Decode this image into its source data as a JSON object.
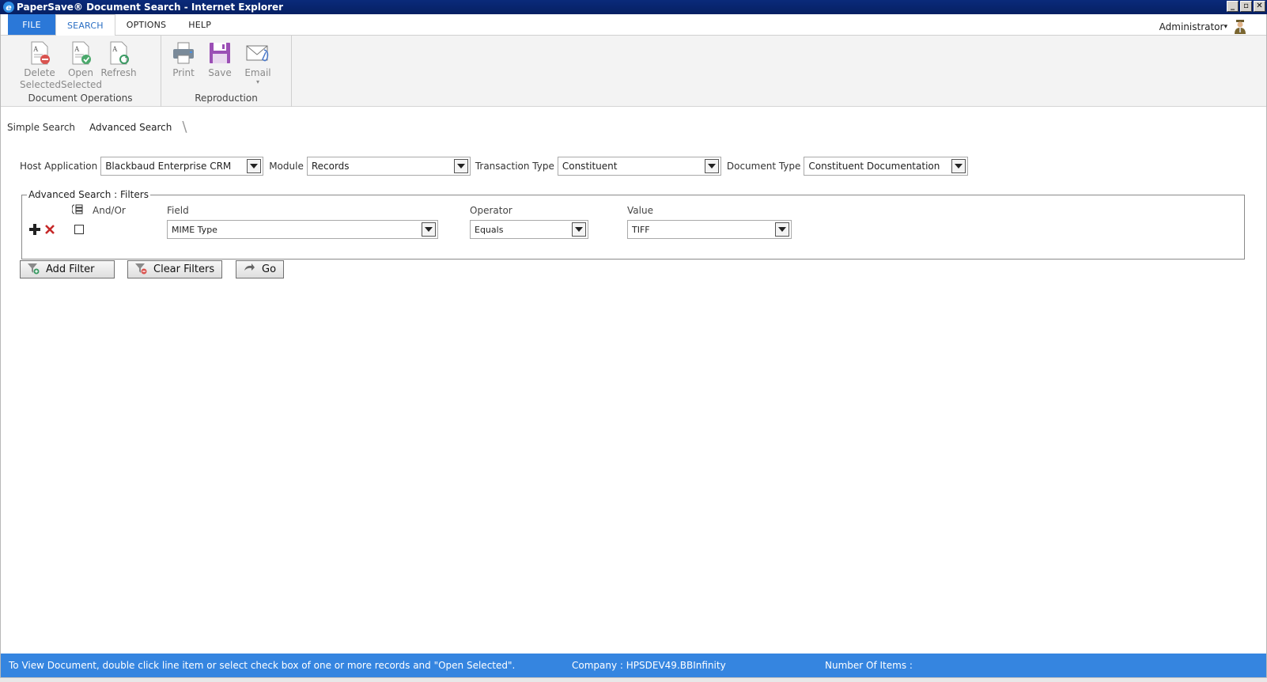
{
  "window": {
    "title": "PaperSave® Document Search - Internet Explorer",
    "icon_letter": "e",
    "minimize": "_",
    "restore": "▫",
    "close": "✕"
  },
  "menu": {
    "file": "FILE",
    "search": "SEARCH",
    "options": "OPTIONS",
    "help": "HELP",
    "user": "Administrator",
    "user_caret": "▾"
  },
  "ribbon": {
    "document_operations": {
      "label": "Document Operations",
      "delete_line1": "Delete",
      "delete_line2": "Selected",
      "open_line1": "Open",
      "open_line2": "Selected",
      "refresh": "Refresh"
    },
    "reproduction": {
      "label": "Reproduction",
      "print": "Print",
      "save": "Save",
      "email": "Email",
      "email_caret": "▾"
    }
  },
  "search_tabs": {
    "simple": "Simple Search",
    "advanced": "Advanced Search",
    "slash": "\\"
  },
  "criteria": {
    "host_application_label": "Host Application",
    "host_application_value": "Blackbaud Enterprise CRM",
    "module_label": "Module",
    "module_value": "Records",
    "transaction_type_label": "Transaction Type",
    "transaction_type_value": "Constituent",
    "document_type_label": "Document Type",
    "document_type_value": "Constituent Documentation"
  },
  "filters": {
    "legend": "Advanced Search : Filters",
    "andor_header": "And/Or",
    "field_header": "Field",
    "operator_header": "Operator",
    "value_header": "Value",
    "row": {
      "field": "MIME Type",
      "operator": "Equals",
      "value": "TIFF"
    }
  },
  "buttons": {
    "add_filter": "Add Filter",
    "clear_filters": "Clear Filters",
    "go": "Go"
  },
  "status": {
    "hint": "To View Document, double click line item or select check box of one or more records and \"Open Selected\".",
    "company": "Company : HPSDEV49.BBInfinity",
    "items": "Number Of Items :"
  },
  "colors": {
    "titlebar": "#0a2a7a",
    "file_tab": "#2b78d8",
    "statusbar": "#3585e0",
    "save_icon": "#9b4fb5"
  }
}
